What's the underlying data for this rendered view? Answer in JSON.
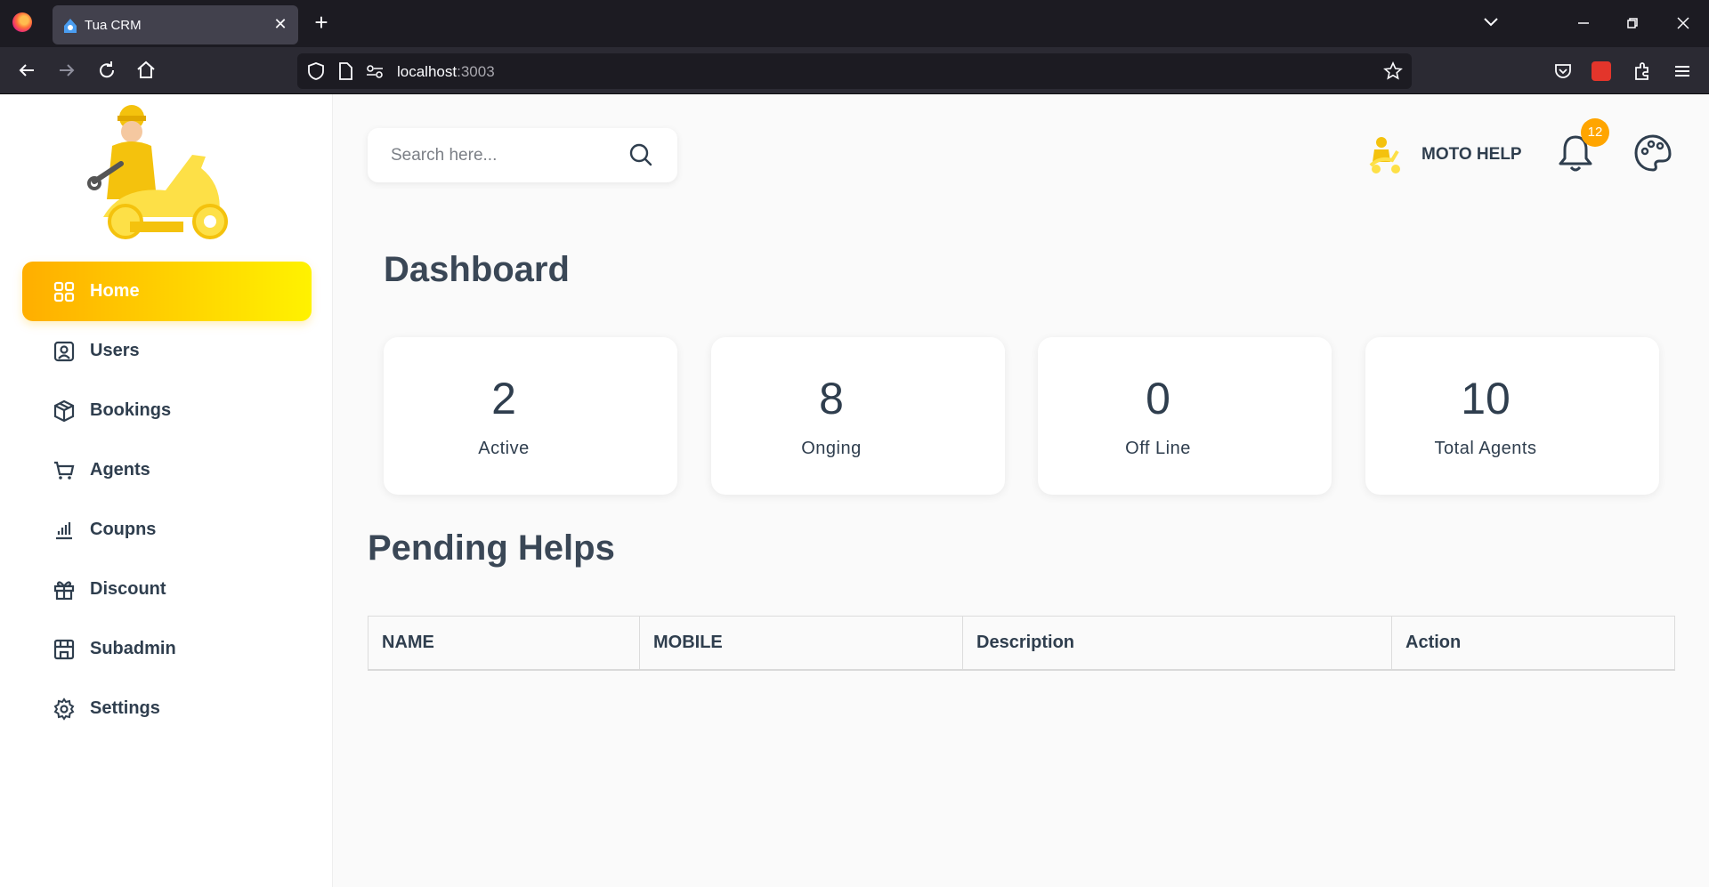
{
  "browser": {
    "tab_title": "Tua CRM",
    "url_host": "localhost",
    "url_port": ":3003"
  },
  "sidebar": {
    "logo_alt": "MOTTO HELP",
    "items": [
      {
        "label": "Home",
        "icon": "grid-icon",
        "active": true
      },
      {
        "label": "Users",
        "icon": "user-badge-icon"
      },
      {
        "label": "Bookings",
        "icon": "box-icon"
      },
      {
        "label": "Agents",
        "icon": "cart-icon"
      },
      {
        "label": "Coupns",
        "icon": "bar-chart-icon"
      },
      {
        "label": "Discount",
        "icon": "gift-icon"
      },
      {
        "label": "Subadmin",
        "icon": "store-icon"
      },
      {
        "label": "Settings",
        "icon": "gear-icon"
      }
    ]
  },
  "header": {
    "search_placeholder": "Search here...",
    "brand_name": "MOTO HELP",
    "notification_count": "12"
  },
  "main": {
    "title": "Dashboard",
    "stats": [
      {
        "value": "2",
        "label": "Active"
      },
      {
        "value": "8",
        "label": "Onging"
      },
      {
        "value": "0",
        "label": "Off Line"
      },
      {
        "value": "10",
        "label": "Total Agents"
      }
    ],
    "section_title": "Pending Helps",
    "table_headers": [
      "NAME",
      "MOBILE",
      "Description",
      "Action"
    ]
  },
  "colors": {
    "accent_start": "#ffae00",
    "accent_end": "#fff200",
    "badge": "#ffa500",
    "text": "#2f3e4e"
  }
}
